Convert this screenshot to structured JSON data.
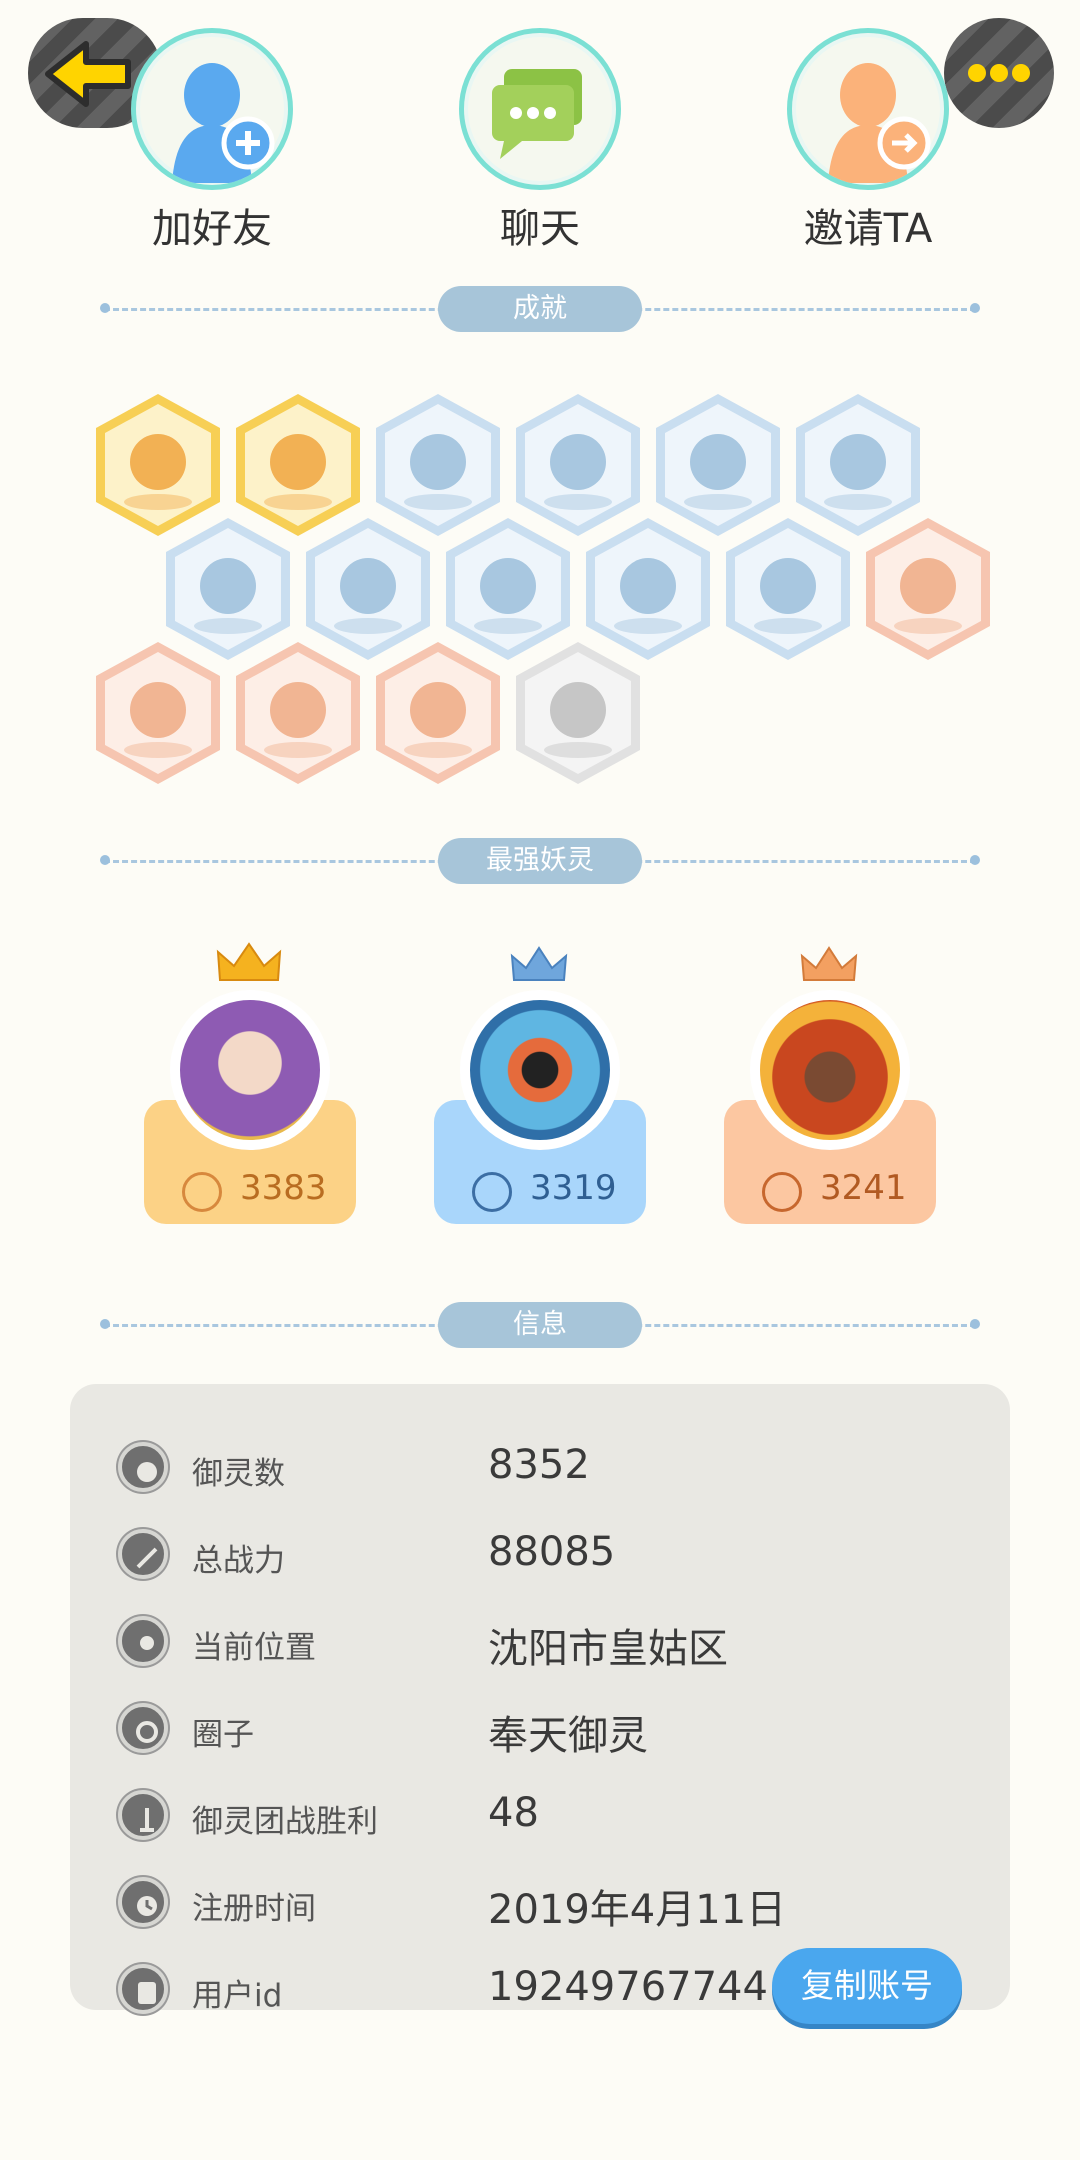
{
  "top_actions": [
    {
      "label": "加好友"
    },
    {
      "label": "聊天"
    },
    {
      "label": "邀请TA"
    }
  ],
  "sections": {
    "achievements": "成就",
    "strongest": "最强妖灵",
    "info": "信息"
  },
  "strongest_spirits": [
    {
      "power": "3383",
      "theme": "#fcd286"
    },
    {
      "power": "3319",
      "theme": "#a9d6fb"
    },
    {
      "power": "3241",
      "theme": "#fcc7a1"
    }
  ],
  "info_rows": [
    {
      "label": "御灵数",
      "value": "8352"
    },
    {
      "label": "总战力",
      "value": "88085"
    },
    {
      "label": "当前位置",
      "value": "沈阳市皇姑区"
    },
    {
      "label": "圈子",
      "value": "奉天御灵"
    },
    {
      "label": "御灵团战胜利",
      "value": "48"
    },
    {
      "label": "注册时间",
      "value": "2019年4月11日"
    },
    {
      "label": "用户id",
      "value": "19249767744"
    }
  ],
  "copy_button": "复制账号",
  "colors": {
    "gold_badge": "#f7cf55",
    "blue_badge": "#c9def0",
    "peach_badge": "#f6c5b0",
    "gray_badge": "#e1e1e1",
    "accent_blue": "#4aa7ee"
  },
  "icons": {
    "back": "arrow-left-icon",
    "more": "ellipsis-icon"
  }
}
